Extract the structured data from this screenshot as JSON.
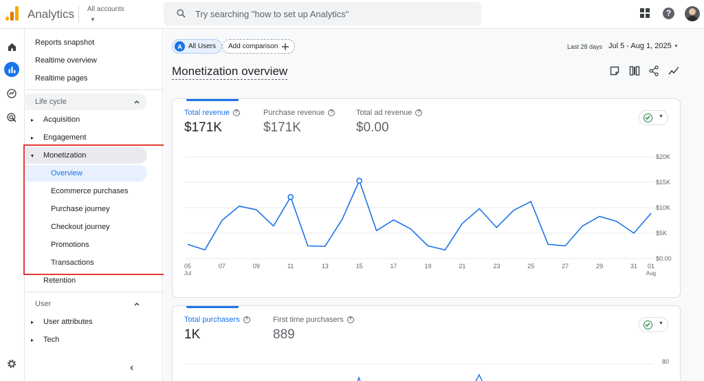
{
  "app": {
    "title": "Analytics",
    "accounts_label": "All accounts",
    "search_placeholder": "Try searching \"how to set up Analytics\""
  },
  "nav": {
    "top_items": [
      "Reports snapshot",
      "Realtime overview",
      "Realtime pages"
    ],
    "lifecycle_section": "Life cycle",
    "acquisition": "Acquisition",
    "engagement": "Engagement",
    "monetization": "Monetization",
    "monetization_items": [
      "Overview",
      "Ecommerce purchases",
      "Purchase journey",
      "Checkout journey",
      "Promotions",
      "Transactions"
    ],
    "retention": "Retention",
    "user_section": "User",
    "user_attributes": "User attributes",
    "tech": "Tech"
  },
  "toolbar": {
    "chip_badge": "A",
    "chip_label": "All Users",
    "add_comparison": "Add comparison",
    "date_label": "Last 28 days",
    "date_value": "Jul 5 - Aug 1, 2025"
  },
  "page_title": "Monetization overview",
  "card1": {
    "metrics": [
      {
        "label": "Total revenue",
        "value": "$171K"
      },
      {
        "label": "Purchase revenue",
        "value": "$171K"
      },
      {
        "label": "Total ad revenue",
        "value": "$0.00"
      }
    ]
  },
  "card2": {
    "metrics": [
      {
        "label": "Total purchasers",
        "value": "1K"
      },
      {
        "label": "First time purchasers",
        "value": "889"
      }
    ],
    "y_tick_top": "80"
  },
  "colors": {
    "accent": "#1a73e8",
    "highlight": "#e53935",
    "check": "#188038"
  },
  "chart_data": {
    "type": "line",
    "series": [
      {
        "values": [
          2.8,
          1.7,
          7.5,
          10.3,
          9.6,
          6.4,
          12.1,
          2.5,
          2.4,
          7.7,
          15.3,
          5.5,
          7.6,
          5.8,
          2.5,
          1.7,
          6.9,
          9.8,
          6.1,
          9.5,
          11.2,
          2.8,
          2.5,
          6.4,
          8.3,
          7.3,
          5.0,
          8.9
        ]
      }
    ],
    "x_ticks": [
      {
        "i": 0,
        "label": "05",
        "sub": "Jul"
      },
      {
        "i": 2,
        "label": "07"
      },
      {
        "i": 4,
        "label": "09"
      },
      {
        "i": 6,
        "label": "11"
      },
      {
        "i": 8,
        "label": "13"
      },
      {
        "i": 10,
        "label": "15"
      },
      {
        "i": 12,
        "label": "17"
      },
      {
        "i": 14,
        "label": "19"
      },
      {
        "i": 16,
        "label": "21"
      },
      {
        "i": 18,
        "label": "23"
      },
      {
        "i": 20,
        "label": "25"
      },
      {
        "i": 22,
        "label": "27"
      },
      {
        "i": 24,
        "label": "29"
      },
      {
        "i": 26,
        "label": "31"
      },
      {
        "i": 27,
        "label": "01",
        "sub": "Aug"
      }
    ],
    "y_ticks": [
      {
        "v": 0,
        "label": "$0.00"
      },
      {
        "v": 5,
        "label": "$5K"
      },
      {
        "v": 10,
        "label": "$10K"
      },
      {
        "v": 15,
        "label": "$15K"
      },
      {
        "v": 20,
        "label": "$20K"
      }
    ],
    "ylim": [
      0,
      20
    ],
    "highlighted_points": [
      6,
      10
    ],
    "grid": true
  }
}
